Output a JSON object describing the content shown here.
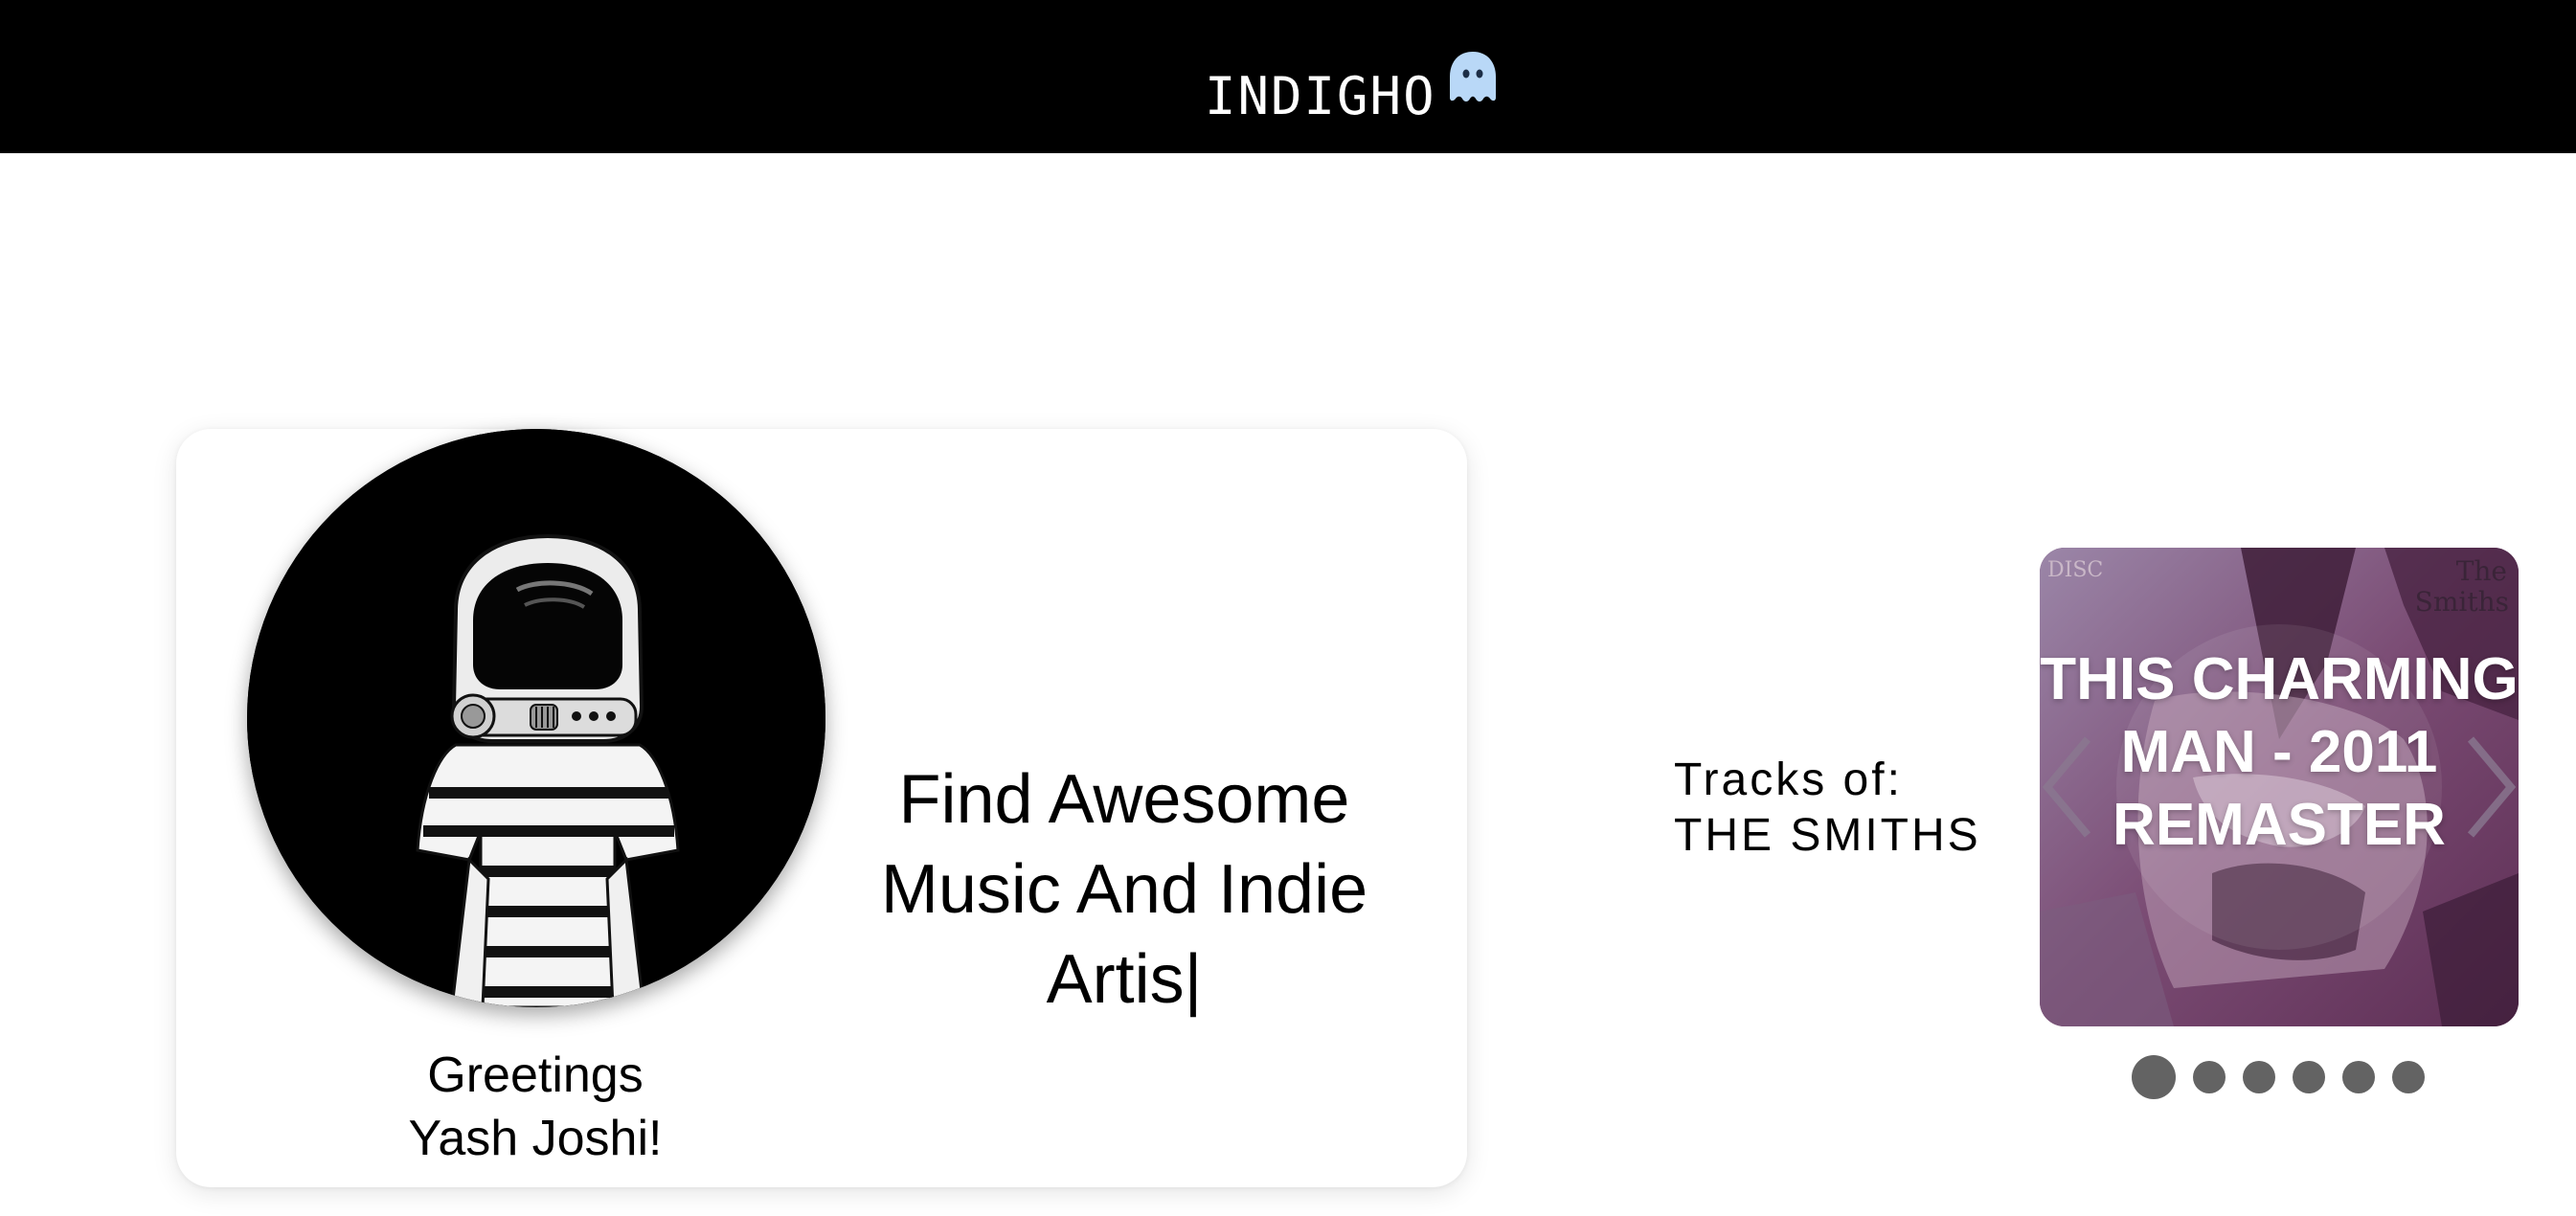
{
  "header": {
    "brand": "INDIGHO",
    "logo_icon": "ghost-icon",
    "background": "#000000",
    "text_color": "#ffffff"
  },
  "hero": {
    "avatar_icon": "astronaut-avatar",
    "greeting_line1": "Greetings",
    "greeting_line2": "Yash Joshi!",
    "tagline": "Find Awesome Music And Indie Artis|"
  },
  "tracks": {
    "label_line1": "Tracks of:",
    "label_line2": "THE SMITHS",
    "current_track": "THIS CHARMING MAN - 2011 REMASTER",
    "cover_text_top_left": "DISC",
    "cover_text_top_right_1": "The",
    "cover_text_top_right_2": "Smiths",
    "slide_count": 6,
    "active_slide": 1,
    "accent_color": "#6b3a62"
  }
}
